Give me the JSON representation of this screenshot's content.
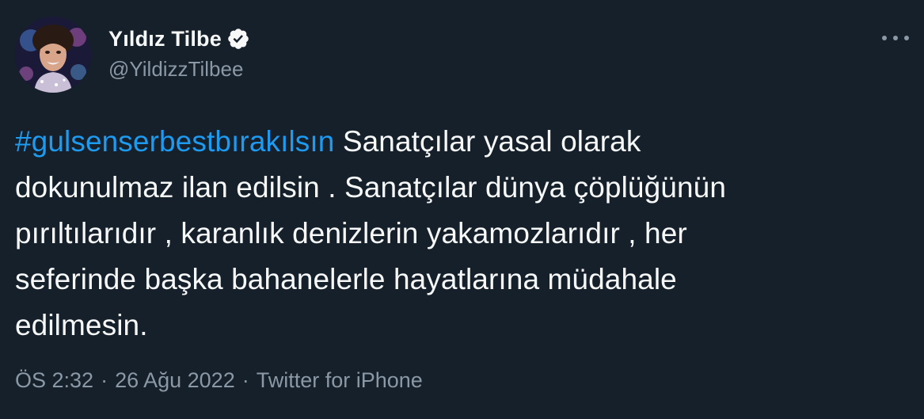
{
  "author": {
    "display_name": "Yıldız Tilbe",
    "handle": "@YildizzTilbee",
    "verified": true
  },
  "tweet": {
    "hashtag": "#gulsenserbestbırakılsın",
    "lines": [
      " Sanatçılar yasal olarak",
      "dokunulmaz ilan edilsin . Sanatçılar dünya çöplüğünün",
      "pırıltılarıdır , karanlık denizlerin yakamozlarıdır , her",
      "seferinde başka bahanelerle hayatlarına müdahale",
      "edilmesin."
    ]
  },
  "meta": {
    "time": "ÖS 2:32",
    "separator": "·",
    "date": "26 Ağu 2022",
    "source": "Twitter for iPhone"
  },
  "icons": {
    "verified": "verified-badge-icon",
    "more": "more-options-icon"
  },
  "colors": {
    "background": "#15202b",
    "text": "#f7f9f9",
    "secondary": "#8b98a5",
    "link": "#1d9bf0"
  }
}
